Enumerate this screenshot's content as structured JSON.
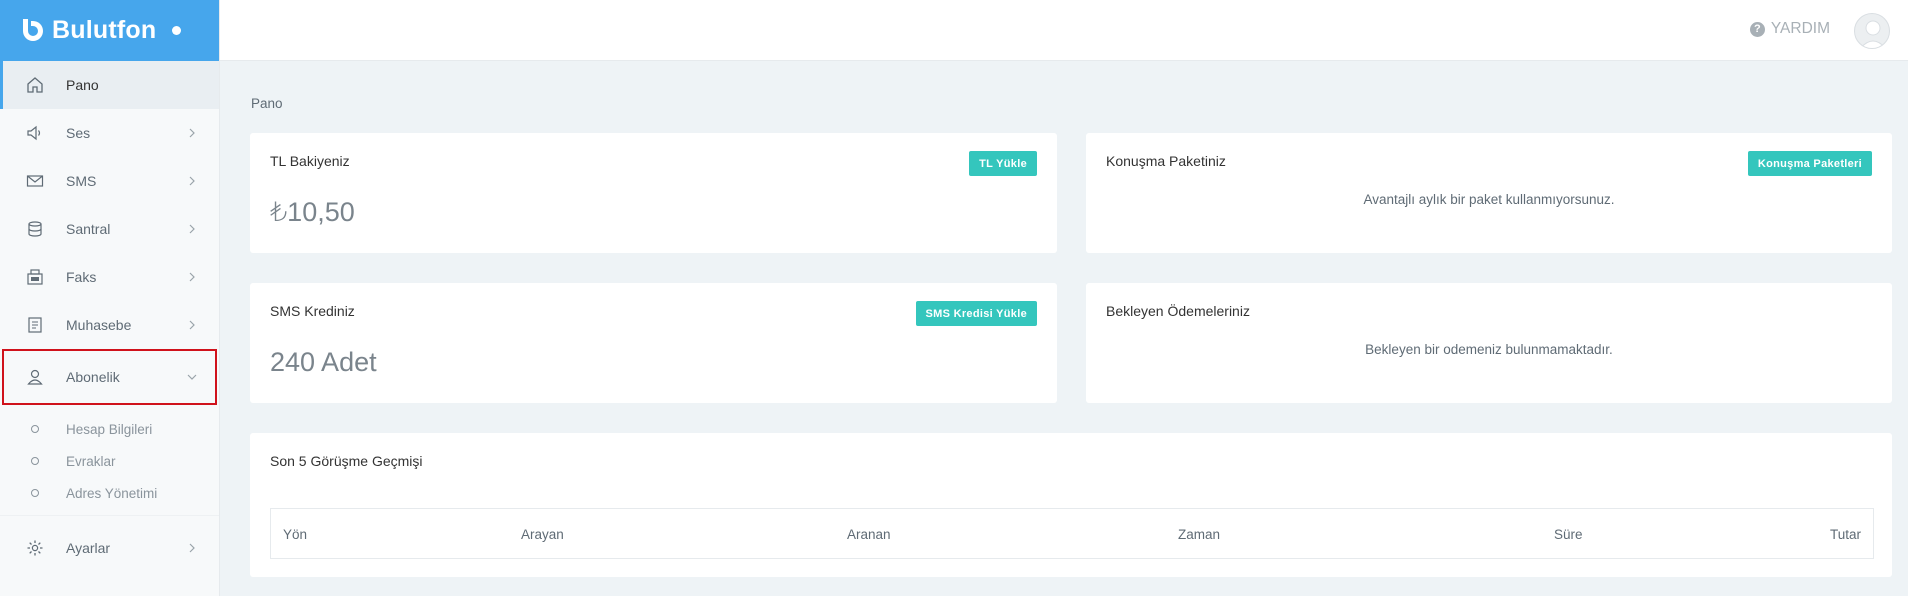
{
  "brand": {
    "name": "Bulutfon"
  },
  "topbar": {
    "help_label": "YARDIM",
    "help_icon": "question-circle-icon"
  },
  "sidebar": {
    "items": [
      {
        "label": "Pano",
        "icon": "home-icon"
      },
      {
        "label": "Ses",
        "icon": "speaker-icon"
      },
      {
        "label": "SMS",
        "icon": "envelope-icon"
      },
      {
        "label": "Santral",
        "icon": "database-icon"
      },
      {
        "label": "Faks",
        "icon": "fax-icon"
      },
      {
        "label": "Muhasebe",
        "icon": "document-icon"
      },
      {
        "label": "Abonelik",
        "icon": "user-icon"
      }
    ],
    "subitems": [
      {
        "label": "Hesap Bilgileri"
      },
      {
        "label": "Evraklar"
      },
      {
        "label": "Adres Yönetimi"
      }
    ],
    "settings": {
      "label": "Ayarlar",
      "icon": "gear-icon"
    }
  },
  "breadcrumb": "Pano",
  "cards": {
    "balance": {
      "title": "TL Bakiyeniz",
      "button": "TL Yükle",
      "value": "₺10,50"
    },
    "package": {
      "title": "Konuşma Paketiniz",
      "button": "Konuşma Paketleri",
      "note": "Avantajlı aylık bir paket kullanmıyorsunuz."
    },
    "sms": {
      "title": "SMS Krediniz",
      "button": "SMS Kredisi Yükle",
      "value": "240 Adet"
    },
    "payments": {
      "title": "Bekleyen Ödemeleriniz",
      "note": "Bekleyen bir odemeniz bulunmamaktadır."
    },
    "history": {
      "title": "Son 5 Görüşme Geçmişi",
      "columns": [
        "Yön",
        "Arayan",
        "Aranan",
        "Zaman",
        "Süre",
        "Tutar"
      ]
    }
  },
  "colors": {
    "brand": "#46a6ec",
    "accent": "#34c6bd",
    "highlight": "#d0121b"
  }
}
